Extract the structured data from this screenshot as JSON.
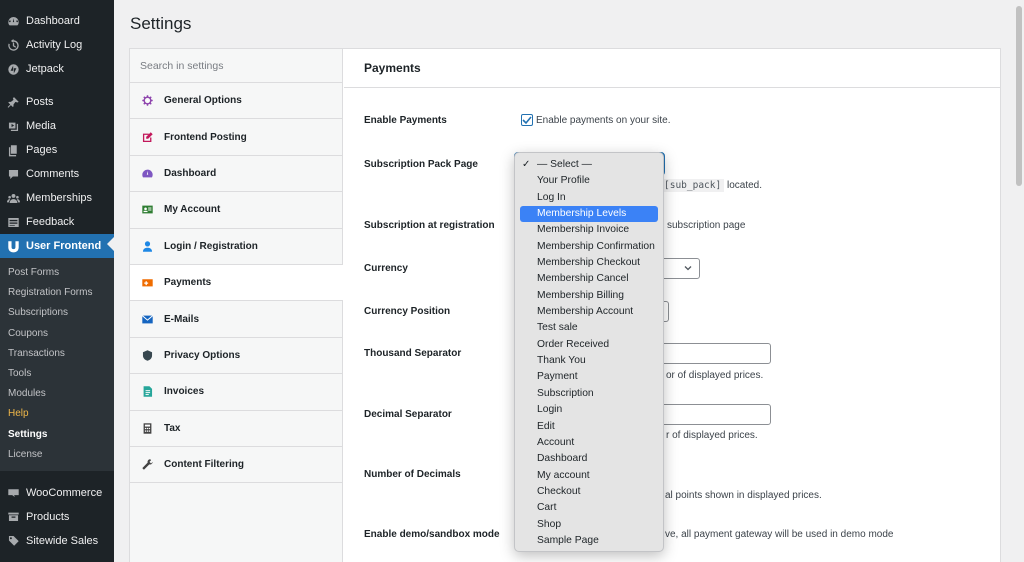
{
  "sidebar": {
    "top_items": [
      {
        "label": "Dashboard",
        "icon": "dashboard-icon"
      },
      {
        "label": "Activity Log",
        "icon": "history-icon"
      },
      {
        "label": "Jetpack",
        "icon": "jetpack-icon"
      }
    ],
    "mid_items": [
      {
        "label": "Posts",
        "icon": "pin-icon"
      },
      {
        "label": "Media",
        "icon": "media-icon"
      },
      {
        "label": "Pages",
        "icon": "pages-icon"
      },
      {
        "label": "Comments",
        "icon": "comments-icon"
      },
      {
        "label": "Memberships",
        "icon": "memberships-icon"
      },
      {
        "label": "Feedback",
        "icon": "feedback-icon"
      }
    ],
    "current_item": {
      "label": "User Frontend",
      "icon": "user-frontend-icon"
    },
    "submenu": [
      "Post Forms",
      "Registration Forms",
      "Subscriptions",
      "Coupons",
      "Transactions",
      "Tools",
      "Modules",
      "Help",
      "Settings",
      "License"
    ],
    "bottom_items": [
      {
        "label": "WooCommerce",
        "icon": "woocommerce-icon"
      },
      {
        "label": "Products",
        "icon": "products-icon"
      },
      {
        "label": "Sitewide Sales",
        "icon": "sitewide-sales-icon"
      }
    ]
  },
  "page": {
    "title": "Settings"
  },
  "settings_nav": {
    "search_placeholder": "Search in settings",
    "items": [
      {
        "label": "General Options",
        "icon": "gear-icon"
      },
      {
        "label": "Frontend Posting",
        "icon": "edit-icon"
      },
      {
        "label": "Dashboard",
        "icon": "dashboard-icon"
      },
      {
        "label": "My Account",
        "icon": "id-card-icon"
      },
      {
        "label": "Login / Registration",
        "icon": "user-icon"
      },
      {
        "label": "Payments",
        "icon": "payments-icon"
      },
      {
        "label": "E-Mails",
        "icon": "envelope-icon"
      },
      {
        "label": "Privacy Options",
        "icon": "shield-icon"
      },
      {
        "label": "Invoices",
        "icon": "invoice-icon"
      },
      {
        "label": "Tax",
        "icon": "tax-icon"
      },
      {
        "label": "Content Filtering",
        "icon": "wrench-icon"
      }
    ],
    "active": "Payments"
  },
  "payments": {
    "section_title": "Payments",
    "enable_payments": {
      "label": "Enable Payments",
      "checkbox_label": "Enable payments on your site.",
      "checked": true
    },
    "subscription_pack_page": {
      "label": "Subscription Pack Page",
      "desc_code": "[sub_pack]",
      "desc_tail": "located."
    },
    "subscription_at_registration": {
      "label": "Subscription at registration",
      "desc_tail": "subscription page"
    },
    "currency": {
      "label": "Currency"
    },
    "currency_position": {
      "label": "Currency Position"
    },
    "thousand_separator": {
      "label": "Thousand Separator",
      "desc_tail": "or of displayed prices."
    },
    "decimal_separator": {
      "label": "Decimal Separator",
      "desc_tail": "r of displayed prices."
    },
    "number_of_decimals": {
      "label": "Number of Decimals",
      "desc_tail": "al points shown in displayed prices."
    },
    "demo_mode": {
      "label": "Enable demo/sandbox mode",
      "desc_tail": "ve, all payment gateway will be used in demo mode"
    }
  },
  "dropdown": {
    "options": [
      "— Select —",
      "Your Profile",
      "Log In",
      "Membership Levels",
      "Membership Invoice",
      "Membership Confirmation",
      "Membership Checkout",
      "Membership Cancel",
      "Membership Billing",
      "Membership Account",
      "Test sale",
      "Order Received",
      "Thank You",
      "Payment",
      "Subscription",
      "Login",
      "Edit",
      "Account",
      "Dashboard",
      "My account",
      "Checkout",
      "Cart",
      "Shop",
      "Sample Page"
    ],
    "checked_option": "— Select —",
    "highlighted_option": "Membership Levels"
  },
  "colors": {
    "sidebar_bg": "#1d2327",
    "accent": "#2271b1",
    "highlight": "#3b82f6",
    "help_orange": "#f0b849"
  }
}
